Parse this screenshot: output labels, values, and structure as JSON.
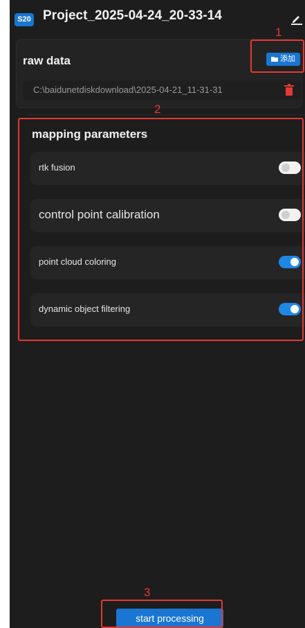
{
  "header": {
    "device_badge": "S20",
    "project_title": "Project_2025-04-24_20-33-14",
    "edit_icon": "pencil-icon"
  },
  "raw_data": {
    "title": "raw data",
    "add_button_label": "添加",
    "add_icon": "folder-add-icon",
    "path": "C:\\baidunetdiskdownload\\2025-04-21_11-31-31",
    "delete_icon": "trash-icon",
    "delete_color": "#e53935"
  },
  "mapping": {
    "title": "mapping parameters",
    "params": [
      {
        "label": "rtk fusion",
        "enabled": false
      },
      {
        "label": "control point calibration",
        "enabled": false
      },
      {
        "label": "point cloud coloring",
        "enabled": true
      },
      {
        "label": "dynamic object filtering",
        "enabled": true
      }
    ]
  },
  "annotations": {
    "n1": "1",
    "n2": "2",
    "n3": "3",
    "color": "#e53935"
  },
  "start_button_label": "start processing",
  "colors": {
    "accent": "#1976d2",
    "toggle_on": "#1e88e5",
    "background": "#1d1d1d"
  }
}
